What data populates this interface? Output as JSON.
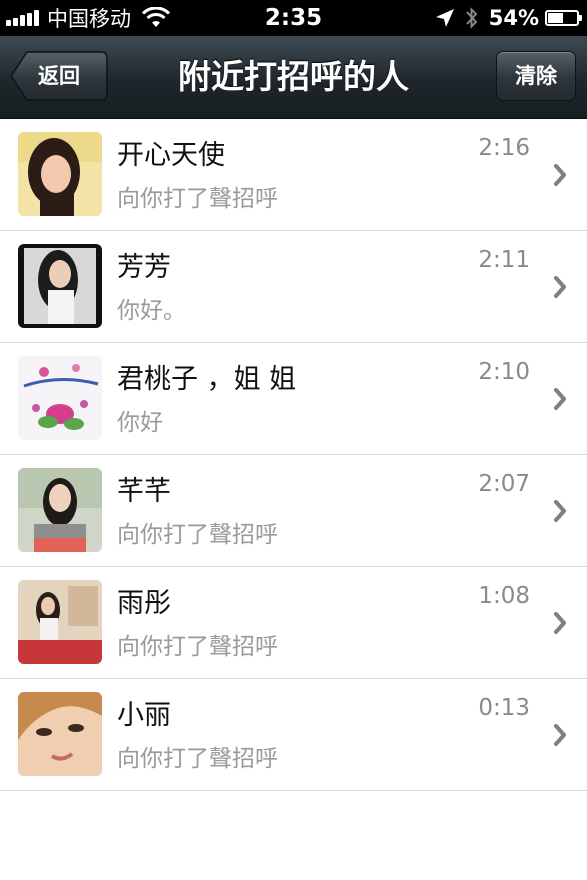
{
  "status_bar": {
    "carrier": "中国移动",
    "time": "2:35",
    "battery_percent": "54%",
    "battery_level": 0.54,
    "icons": [
      "signal-icon",
      "wifi-icon",
      "location-arrow-icon",
      "bluetooth-icon",
      "battery-icon"
    ]
  },
  "nav": {
    "title": "附近打招呼的人",
    "back_label": "返回",
    "clear_label": "清除"
  },
  "items": [
    {
      "name": "开心天使",
      "message": "向你打了聲招呼",
      "time": "2:16"
    },
    {
      "name": "芳芳",
      "message": "你好。",
      "time": "2:11"
    },
    {
      "name": "君桃子 ，姐 姐",
      "message": "你好",
      "time": "2:10"
    },
    {
      "name": "芊芊",
      "message": "向你打了聲招呼",
      "time": "2:07"
    },
    {
      "name": "雨彤",
      "message": "向你打了聲招呼",
      "time": "1:08"
    },
    {
      "name": "小丽",
      "message": "向你打了聲招呼",
      "time": "0:13"
    }
  ],
  "colors": {
    "nav_bg": "#1f272c",
    "time_text": "#8a8a8a",
    "message_text": "#9a9a9a",
    "chevron": "#808080"
  }
}
